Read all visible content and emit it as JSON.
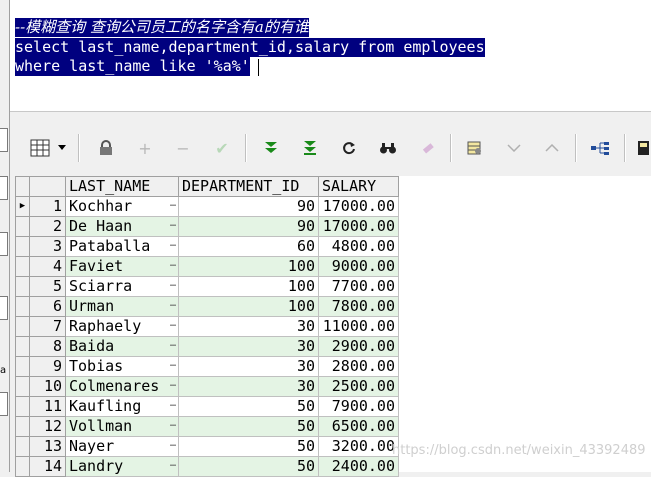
{
  "editor": {
    "lines": [
      "--模糊查询 查询公司员工的名字含有a的有谁",
      "select last_name,department_id,salary from employees",
      "where last_name like '%a%'"
    ]
  },
  "toolbar": {
    "icons": [
      "grid-layout-icon",
      "dropdown-arrow-icon",
      "lock-icon",
      "add-record-icon",
      "delete-record-icon",
      "post-edit-icon",
      "fetch-next-icon",
      "fetch-last-icon",
      "refresh-icon",
      "find-icon",
      "clear-icon",
      "query-by-example-icon",
      "sort-descending-icon",
      "sort-ascending-icon",
      "tree-view-icon",
      "export-icon"
    ]
  },
  "grid": {
    "columns": [
      "LAST_NAME",
      "DEPARTMENT_ID",
      "SALARY"
    ],
    "rows": [
      {
        "no": "1",
        "last_name": "Kochhar",
        "department_id": "90",
        "salary": "17000.00"
      },
      {
        "no": "2",
        "last_name": "De Haan",
        "department_id": "90",
        "salary": "17000.00"
      },
      {
        "no": "3",
        "last_name": "Pataballa",
        "department_id": "60",
        "salary": "4800.00"
      },
      {
        "no": "4",
        "last_name": "Faviet",
        "department_id": "100",
        "salary": "9000.00"
      },
      {
        "no": "5",
        "last_name": "Sciarra",
        "department_id": "100",
        "salary": "7700.00"
      },
      {
        "no": "6",
        "last_name": "Urman",
        "department_id": "100",
        "salary": "7800.00"
      },
      {
        "no": "7",
        "last_name": "Raphaely",
        "department_id": "30",
        "salary": "11000.00"
      },
      {
        "no": "8",
        "last_name": "Baida",
        "department_id": "30",
        "salary": "2900.00"
      },
      {
        "no": "9",
        "last_name": "Tobias",
        "department_id": "30",
        "salary": "2800.00"
      },
      {
        "no": "10",
        "last_name": "Colmenares",
        "department_id": "30",
        "salary": "2500.00"
      },
      {
        "no": "11",
        "last_name": "Kaufling",
        "department_id": "50",
        "salary": "7900.00"
      },
      {
        "no": "12",
        "last_name": "Vollman",
        "department_id": "50",
        "salary": "6500.00"
      },
      {
        "no": "13",
        "last_name": "Nayer",
        "department_id": "50",
        "salary": "3200.00"
      },
      {
        "no": "14",
        "last_name": "Landry",
        "department_id": "50",
        "salary": "2400.00"
      }
    ]
  },
  "left_strip": {
    "label": "a"
  },
  "watermark": "https://blog.csdn.net/weixin_43392489"
}
